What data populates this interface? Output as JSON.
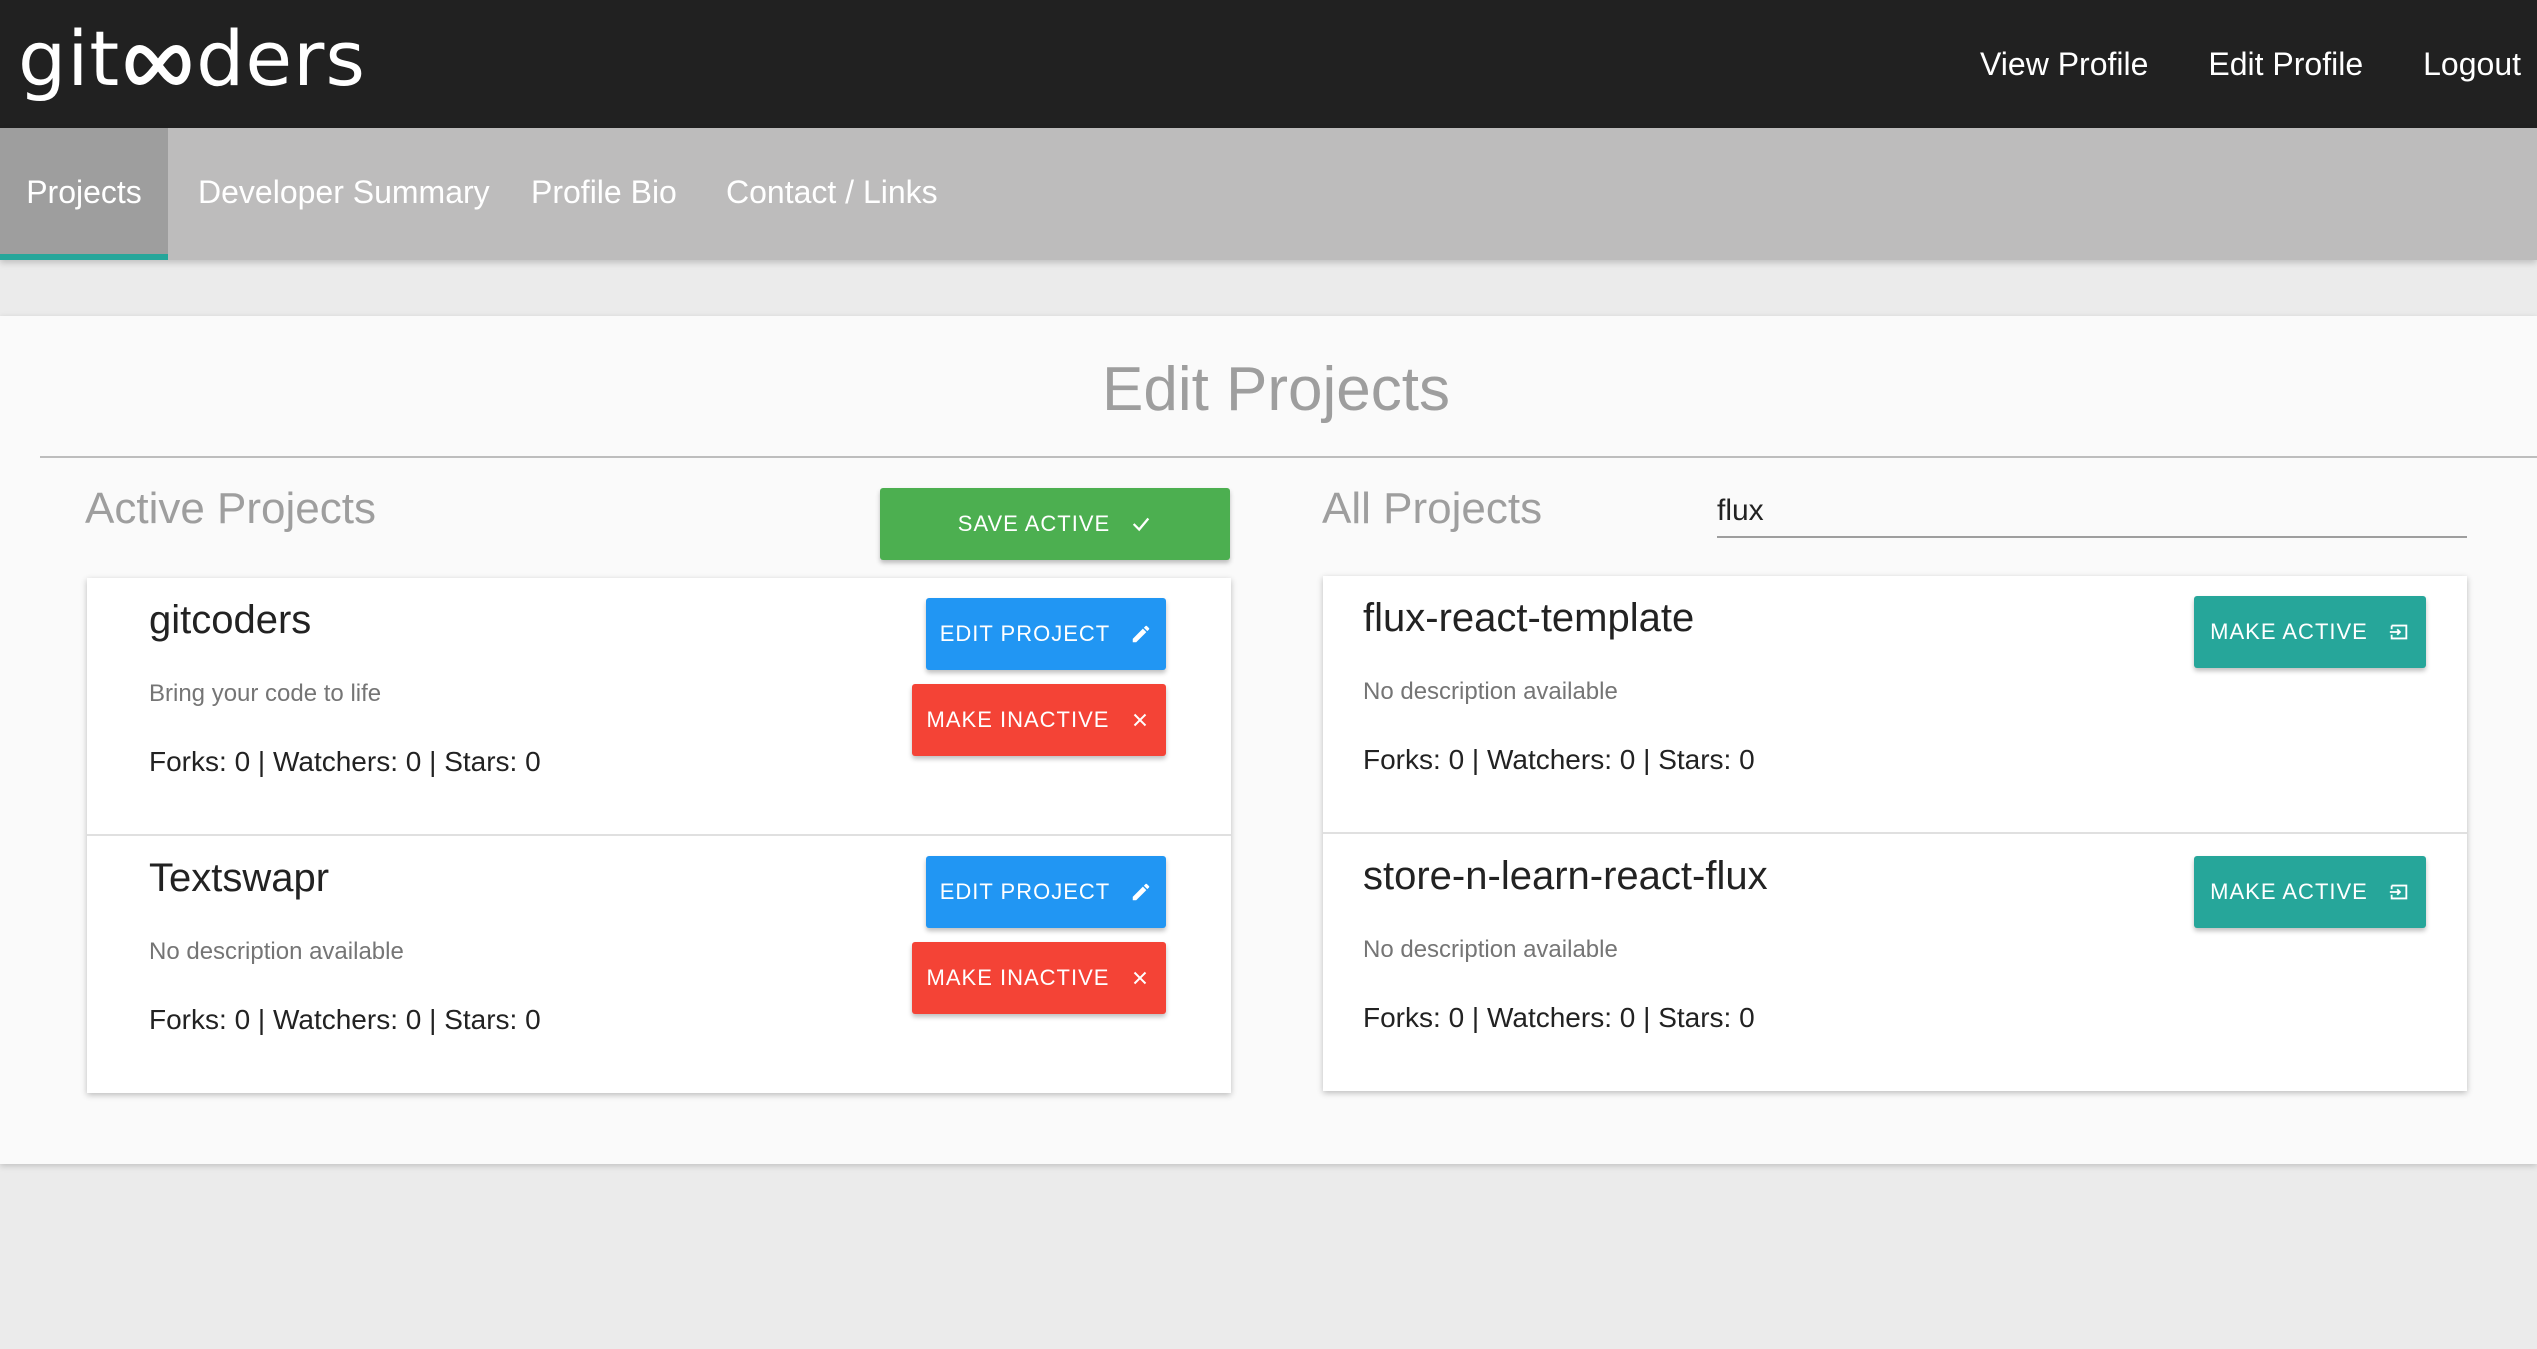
{
  "header": {
    "logo_left": "git",
    "logo_right": "ders",
    "nav": [
      "View Profile",
      "Edit Profile",
      "Logout"
    ]
  },
  "tabs": [
    "Projects",
    "Developer Summary",
    "Profile Bio",
    "Contact / Links"
  ],
  "main": {
    "title": "Edit Projects",
    "active": {
      "title": "Active Projects",
      "save_label": "SAVE ACTIVE",
      "projects": [
        {
          "name": "gitcoders",
          "description": "Bring your code to life",
          "stats": [
            "Forks: ",
            "0",
            " | ",
            "Watchers: ",
            "0",
            " | ",
            "Stars: ",
            "0"
          ],
          "edit_label": "EDIT PROJECT",
          "inactive_label": "MAKE INACTIVE"
        },
        {
          "name": "Textswapr",
          "description": "No description available",
          "stats": [
            "Forks: ",
            "0",
            " | ",
            "Watchers: ",
            "0",
            " | ",
            "Stars: ",
            "0"
          ],
          "edit_label": "EDIT PROJECT",
          "inactive_label": "MAKE INACTIVE"
        }
      ]
    },
    "all": {
      "title": "All Projects",
      "search_value": "flux",
      "projects": [
        {
          "name": "flux-react-template",
          "description": "No description available",
          "stats": [
            "Forks: ",
            "0",
            " | ",
            "Watchers: ",
            "0",
            " | ",
            "Stars: ",
            "0"
          ],
          "active_label": "MAKE ACTIVE"
        },
        {
          "name": "store-n-learn-react-flux",
          "description": "No description available",
          "stats": [
            "Forks: ",
            "0",
            " | ",
            "Watchers: ",
            "0",
            " | ",
            "Stars: ",
            "0"
          ],
          "active_label": "MAKE ACTIVE"
        }
      ]
    }
  },
  "colors": {
    "topbar": "#212121",
    "tabbar": "#bdbcbc",
    "tab_active": "#9e9e9e",
    "accent_teal": "#26a69a",
    "green": "#4caf50",
    "blue": "#2196f3",
    "red": "#f44336"
  },
  "icons": {
    "save": "check-icon",
    "edit": "pencil-icon",
    "inactive": "close-icon",
    "active": "input-icon"
  }
}
